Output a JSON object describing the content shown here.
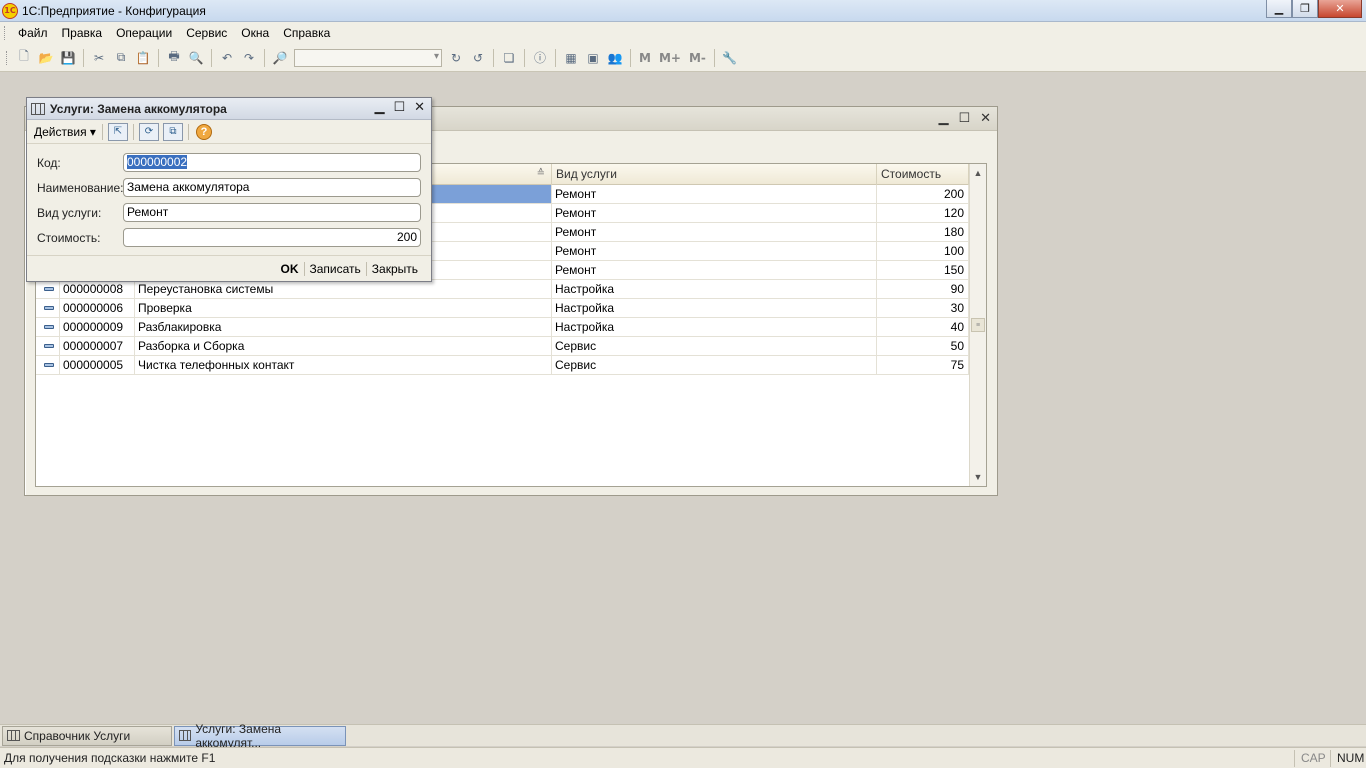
{
  "window": {
    "title": "1С:Предприятие - Конфигурация",
    "logo_text": "1С"
  },
  "menu": [
    {
      "label": "Файл"
    },
    {
      "label": "Правка"
    },
    {
      "label": "Операции"
    },
    {
      "label": "Сервис"
    },
    {
      "label": "Окна"
    },
    {
      "label": "Справка"
    }
  ],
  "toolbar": {
    "m_label": "M",
    "mplus_label": "M+",
    "mminus_label": "M-"
  },
  "list": {
    "columns": {
      "type": "Вид услуги",
      "cost": "Стоимость"
    },
    "rows": [
      {
        "code": "",
        "name": "",
        "type": "Ремонт",
        "cost": "200"
      },
      {
        "code": "",
        "name": "",
        "type": "Ремонт",
        "cost": "120"
      },
      {
        "code": "",
        "name": "",
        "type": "Ремонт",
        "cost": "180"
      },
      {
        "code": "",
        "name": "",
        "type": "Ремонт",
        "cost": "100"
      },
      {
        "code": "",
        "name": "",
        "type": "Ремонт",
        "cost": "150"
      },
      {
        "code": "000000008",
        "name": "Переустановка системы",
        "type": "Настройка",
        "cost": "90"
      },
      {
        "code": "000000006",
        "name": "Проверка",
        "type": "Настройка",
        "cost": "30"
      },
      {
        "code": "000000009",
        "name": "Разблакировка",
        "type": "Настройка",
        "cost": "40"
      },
      {
        "code": "000000007",
        "name": "Разборка и Сборка",
        "type": "Сервис",
        "cost": "50"
      },
      {
        "code": "000000005",
        "name": "Чистка телефонных контакт",
        "type": "Сервис",
        "cost": "75"
      }
    ]
  },
  "dialog": {
    "title": "Услуги: Замена аккомулятора",
    "actions_label": "Действия",
    "help_glyph": "?",
    "fields": {
      "code_label": "Код:",
      "code_value": "000000002",
      "name_label": "Наименование:",
      "name_value": "Замена аккомулятора",
      "type_label": "Вид услуги:",
      "type_value": "Ремонт",
      "cost_label": "Стоимость:",
      "cost_value": "200"
    },
    "buttons": {
      "ok": "OK",
      "save": "Записать",
      "close": "Закрыть"
    }
  },
  "taskbar": [
    {
      "label": "Справочник Услуги"
    },
    {
      "label": "Услуги: Замена аккомулят..."
    }
  ],
  "status": {
    "hint": "Для получения подсказки нажмите F1",
    "cap": "CAP",
    "num": "NUM"
  }
}
